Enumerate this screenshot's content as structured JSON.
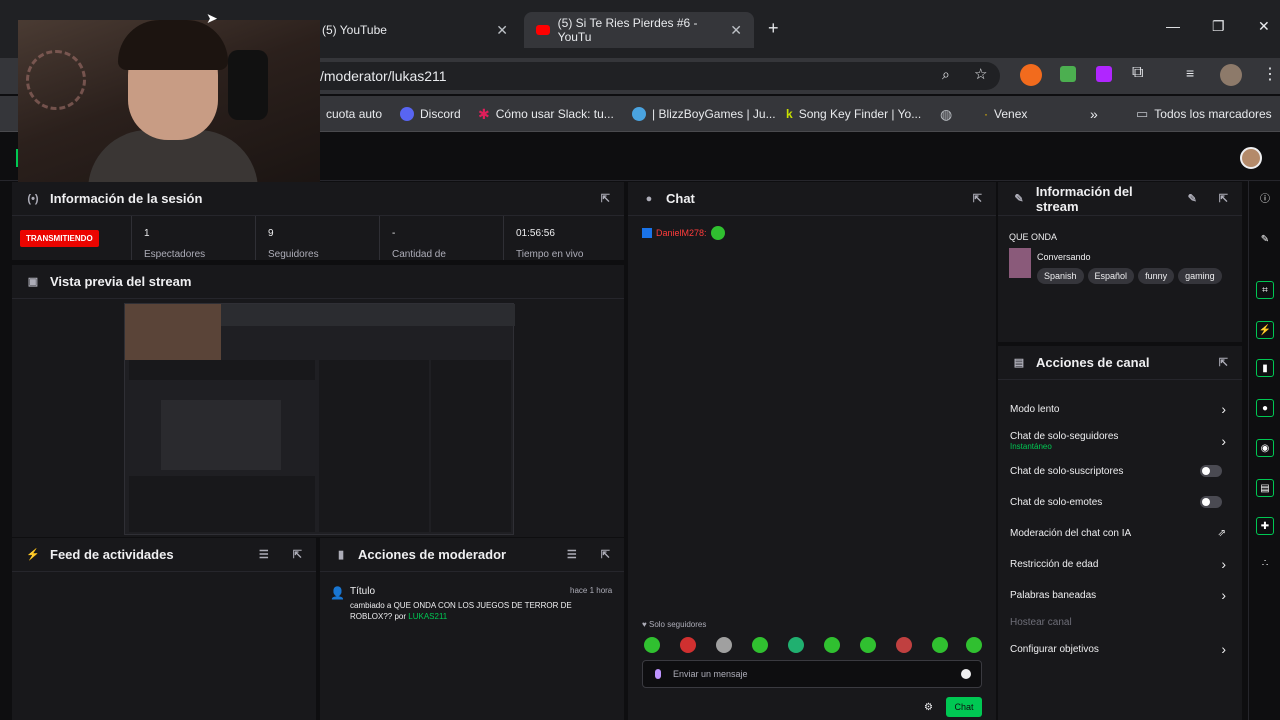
{
  "browser": {
    "tabs": [
      {
        "label": "(5) YouTube"
      },
      {
        "label": "(5) Si Te Ries Pierdes #6 - YouTu"
      }
    ],
    "address": "/moderator/lukas211",
    "bookmarks": [
      {
        "label": "cuota auto"
      },
      {
        "label": "Discord"
      },
      {
        "label": "Cómo usar Slack: tu..."
      },
      {
        "label": "| BlizzBoyGames | Ju..."
      },
      {
        "label": "Song Key Finder | Yo..."
      },
      {
        "label": "Venex"
      },
      {
        "label": "Todos los marcadores"
      }
    ]
  },
  "session": {
    "title": "Información de la sesión",
    "live_badge": "TRANSMITIENDO",
    "stats": [
      {
        "value": "1",
        "label": "Espectadores"
      },
      {
        "value": "9",
        "label": "Seguidores"
      },
      {
        "value": "-",
        "label": "Cantidad de"
      },
      {
        "value": "01:56:56",
        "label": "Tiempo en vivo"
      }
    ]
  },
  "preview": {
    "title": "Vista previa del stream"
  },
  "activity": {
    "title": "Feed de actividades"
  },
  "modactions": {
    "title": "Acciones de moderador",
    "entry": {
      "title": "Título",
      "time": "hace 1 hora",
      "text": "cambiado a QUE ONDA CON LOS JUEGOS DE TERROR DE ROBLOX?? por",
      "user": "LUKAS211"
    }
  },
  "chat": {
    "title": "Chat",
    "messages": [
      {
        "user": "DanielM278:"
      }
    ],
    "mode": "Solo seguidores",
    "placeholder": "Enviar un mensaje",
    "send_label": "Chat"
  },
  "stream_info": {
    "title": "Información del stream",
    "stream_title": "QUE ONDA",
    "category": "Conversando",
    "tags": [
      "Spanish",
      "Español",
      "funny",
      "gaming"
    ]
  },
  "channel_actions": {
    "title": "Acciones de canal",
    "items": [
      {
        "label": "Modo lento",
        "type": "arrow"
      },
      {
        "label": "Chat de solo-seguidores",
        "sub": "Instantáneo",
        "type": "arrow"
      },
      {
        "label": "Chat de solo-suscriptores",
        "type": "toggle"
      },
      {
        "label": "Chat de solo-emotes",
        "type": "toggle"
      },
      {
        "label": "Moderación del chat con IA",
        "type": "external"
      },
      {
        "label": "Restricción de edad",
        "type": "arrow"
      },
      {
        "label": "Palabras baneadas",
        "type": "arrow"
      },
      {
        "label": "Hostear canal",
        "type": "disabled"
      },
      {
        "label": "Configurar objetivos",
        "type": "arrow"
      }
    ]
  },
  "colors": {
    "accent": "#00c853",
    "live": "#eb0400",
    "chat_user": "#ff3b3b"
  }
}
